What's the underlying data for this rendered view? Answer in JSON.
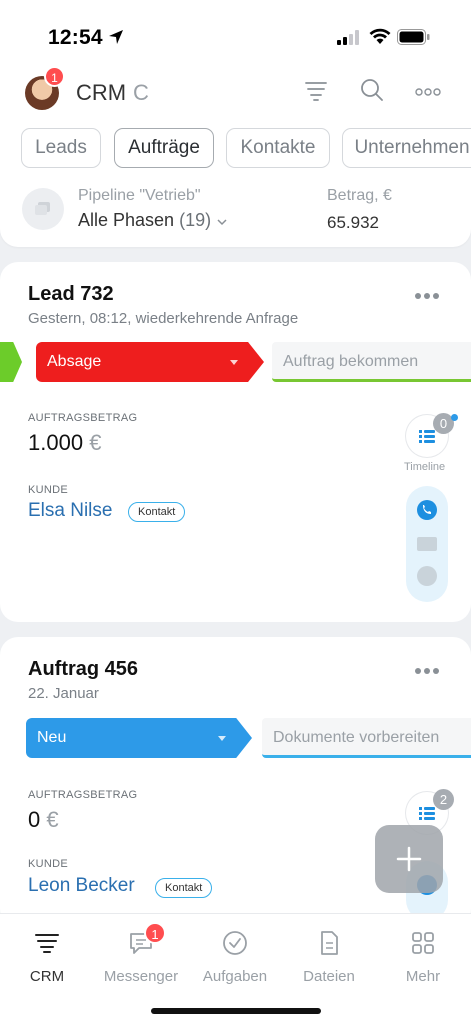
{
  "status_bar": {
    "time": "12:54"
  },
  "header": {
    "app_title": "CRM",
    "loading_glyph": "C",
    "avatar_badge": "1",
    "icons": [
      "filter-icon",
      "search-icon",
      "more-icon"
    ]
  },
  "tabs": [
    {
      "label": "Leads",
      "active": false
    },
    {
      "label": "Aufträge",
      "active": true
    },
    {
      "label": "Kontakte",
      "active": false
    },
    {
      "label": "Unternehmen",
      "active": false
    }
  ],
  "pipeline": {
    "label": "Pipeline \"Vetrieb\"",
    "phase": "Alle Phasen",
    "count": "(19)",
    "amount_label": "Betrag, €",
    "amount_value": "65.932"
  },
  "cards": [
    {
      "title": "Lead 732",
      "subtitle": "Gestern, 08:12, wiederkehrende Anfrage",
      "stage": "Absage",
      "next_stage": "Auftrag bekommen",
      "amount_label": "AUFTRAGSBETRAG",
      "amount": "1.000",
      "currency": "€",
      "client_label": "KUNDE",
      "client": "Elsa Nilse",
      "client_tag": "Kontakt",
      "timeline_count": "0",
      "timeline_label": "Timeline"
    },
    {
      "title": "Auftrag 456",
      "subtitle": "22. Januar",
      "stage": "Neu",
      "next_stage": "Dokumente vorbereiten",
      "amount_label": "AUFTRAGSBETRAG",
      "amount": "0",
      "currency": "€",
      "client_label": "KUNDE",
      "client": "Leon Becker",
      "client_tag": "Kontakt",
      "timeline_count": "2"
    }
  ],
  "bottom_nav": [
    {
      "label": "CRM",
      "icon": "crm-icon",
      "active": true
    },
    {
      "label": "Messenger",
      "icon": "chat-icon",
      "badge": "1"
    },
    {
      "label": "Aufgaben",
      "icon": "check-circle-icon"
    },
    {
      "label": "Dateien",
      "icon": "file-icon"
    },
    {
      "label": "Mehr",
      "icon": "grid-icon"
    }
  ],
  "colors": {
    "stage_red": "#ee1e1e",
    "stage_blue": "#2d9ae8",
    "stage_green": "#6ccc2a",
    "link": "#2a6fb0",
    "badge": "#ff4d4f"
  }
}
